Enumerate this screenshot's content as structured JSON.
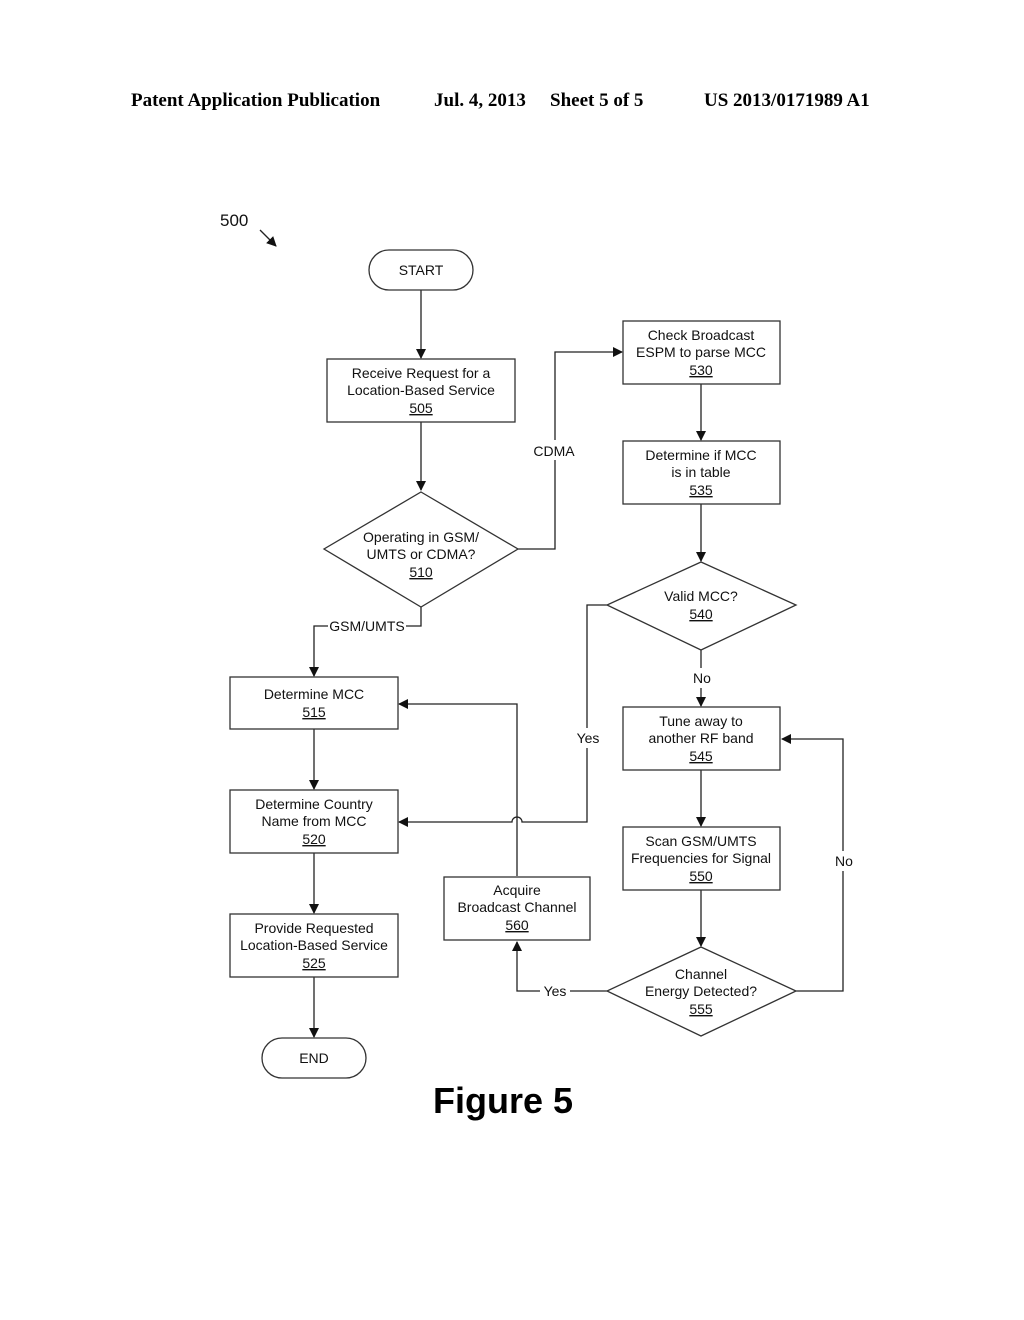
{
  "header": {
    "publication_type": "Patent Application Publication",
    "date": "Jul. 4, 2013",
    "sheet": "Sheet 5 of 5",
    "number": "US 2013/0171989 A1"
  },
  "diagram": {
    "id": "500",
    "figure_label": "Figure 5",
    "nodes": {
      "start": {
        "lines": [
          "START"
        ],
        "ref": ""
      },
      "n505": {
        "lines": [
          "Receive Request for a",
          "Location-Based Service"
        ],
        "ref": "505"
      },
      "n510": {
        "lines": [
          "Operating in GSM/",
          "UMTS or CDMA?"
        ],
        "ref": "510"
      },
      "n515": {
        "lines": [
          "Determine MCC"
        ],
        "ref": "515"
      },
      "n520": {
        "lines": [
          "Determine Country",
          "Name from MCC"
        ],
        "ref": "520"
      },
      "n525": {
        "lines": [
          "Provide Requested",
          "Location-Based Service"
        ],
        "ref": "525"
      },
      "end": {
        "lines": [
          "END"
        ],
        "ref": ""
      },
      "n530": {
        "lines": [
          "Check Broadcast",
          "ESPM to parse MCC"
        ],
        "ref": "530"
      },
      "n535": {
        "lines": [
          "Determine if MCC",
          "is in table"
        ],
        "ref": "535"
      },
      "n540": {
        "lines": [
          "Valid MCC?"
        ],
        "ref": "540"
      },
      "n545": {
        "lines": [
          "Tune away to",
          "another RF band"
        ],
        "ref": "545"
      },
      "n550": {
        "lines": [
          "Scan GSM/UMTS",
          "Frequencies for Signal"
        ],
        "ref": "550"
      },
      "n555": {
        "lines": [
          "Channel",
          "Energy Detected?"
        ],
        "ref": "555"
      },
      "n560": {
        "lines": [
          "Acquire",
          "Broadcast Channel"
        ],
        "ref": "560"
      }
    },
    "edge_labels": {
      "cdma": "CDMA",
      "gsm_umts": "GSM/UMTS",
      "yes_540": "Yes",
      "no_540": "No",
      "no_555": "No",
      "yes_555": "Yes"
    }
  }
}
